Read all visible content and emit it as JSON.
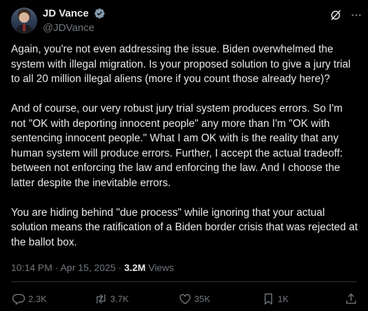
{
  "author": {
    "display_name": "JD Vance",
    "handle": "@JDVance"
  },
  "post": {
    "paragraphs": [
      "Again, you're not even addressing the issue. Biden overwhelmed the system with illegal migration. Is your proposed solution to give a jury trial to all 20 million illegal aliens (more if you count those already here)?",
      "And of course, our very robust jury trial system produces errors. So I'm not \"OK with deporting innocent people\" any more than I'm \"OK with sentencing innocent people.\" What I am OK with is the reality that any human system will produce errors. Further, I accept the actual tradeoff: between not enforcing the law and enforcing the law. And I choose the latter despite the inevitable errors.",
      "You are hiding behind \"due process\" while ignoring that your actual solution means the ratification of a Biden border crisis that was rejected at the ballot box."
    ],
    "timestamp": "10:14 PM · Apr 15, 2025",
    "separator": " · ",
    "views_count": "3.2M",
    "views_label": " Views"
  },
  "actions": {
    "replies": "2.3K",
    "reposts": "3.7K",
    "likes": "35K",
    "bookmarks": "1K"
  },
  "icons": [
    "verified-icon",
    "grok-icon",
    "more-icon",
    "reply-icon",
    "repost-icon",
    "like-icon",
    "bookmark-icon",
    "share-icon"
  ],
  "colors": {
    "background": "#000000",
    "text": "#e7e9ea",
    "muted": "#71767b",
    "verified": "#829aab",
    "divider": "#2f3336"
  }
}
